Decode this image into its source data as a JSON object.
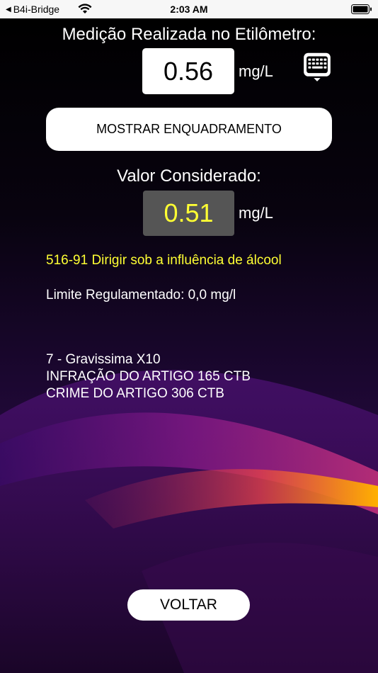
{
  "status_bar": {
    "back_app": "B4i-Bridge",
    "time": "2:03 AM"
  },
  "measurement": {
    "title": "Medição Realizada no Etilômetro:",
    "value": "0.56",
    "unit": "mg/L",
    "keyboard_icon": "keyboard-icon"
  },
  "buttons": {
    "show_framing": "MOSTRAR ENQUADRAMENTO",
    "back": "VOLTAR"
  },
  "considered": {
    "title": "Valor Considerado:",
    "value": "0.51",
    "unit": "mg/L"
  },
  "result": {
    "infraction": "516-91 Dirigir sob a influência de álcool",
    "limit": "Limite Regulamentado: 0,0 mg/l",
    "gravity": "7 - Gravissima X10",
    "article_infraction": "INFRAÇÃO DO ARTIGO 165 CTB",
    "article_crime": "CRIME DO ARTIGO 306 CTB"
  },
  "colors": {
    "highlight": "#ffff33",
    "considered_box": "#555555"
  }
}
